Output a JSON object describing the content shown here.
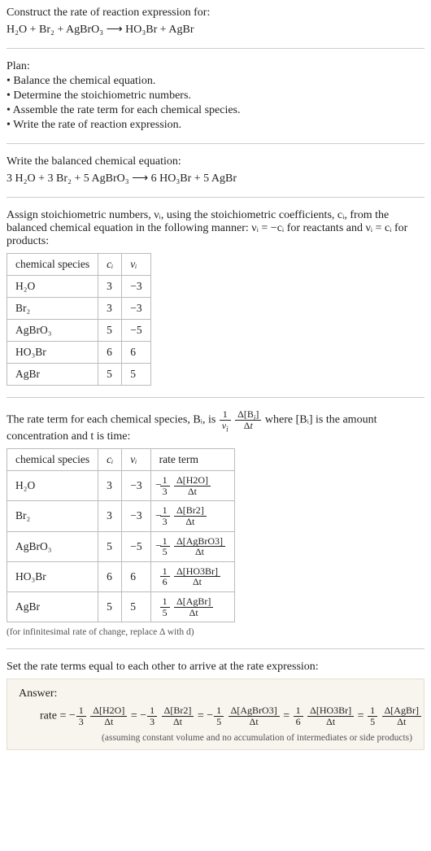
{
  "intro": {
    "line1": "Construct the rate of reaction expression for:",
    "eq": "H₂O + Br₂ + AgBrO₃ ⟶ HO₃Br + AgBr"
  },
  "plan": {
    "heading": "Plan:",
    "items": [
      "• Balance the chemical equation.",
      "• Determine the stoichiometric numbers.",
      "• Assemble the rate term for each chemical species.",
      "• Write the rate of reaction expression."
    ]
  },
  "balanced": {
    "line1": "Write the balanced chemical equation:",
    "eq": "3 H₂O + 3 Br₂ + 5 AgBrO₃ ⟶ 6 HO₃Br + 5 AgBr"
  },
  "assign": {
    "paragraph": "Assign stoichiometric numbers, νᵢ, using the stoichiometric coefficients, cᵢ, from the balanced chemical equation in the following manner: νᵢ = −cᵢ for reactants and νᵢ = cᵢ for products:",
    "headers": [
      "chemical species",
      "cᵢ",
      "νᵢ"
    ],
    "rows": [
      [
        "H₂O",
        "3",
        "−3"
      ],
      [
        "Br₂",
        "3",
        "−3"
      ],
      [
        "AgBrO₃",
        "5",
        "−5"
      ],
      [
        "HO₃Br",
        "6",
        "6"
      ],
      [
        "AgBr",
        "5",
        "5"
      ]
    ]
  },
  "rateterm": {
    "paragraph": "",
    "headers": [
      "chemical species",
      "cᵢ",
      "νᵢ",
      "rate term"
    ],
    "rows": [
      {
        "sp": "H₂O",
        "c": "3",
        "v": "−3",
        "coef": "− ⅓",
        "dnum": "Δ[H2O]",
        "dden": "Δt"
      },
      {
        "sp": "Br₂",
        "c": "3",
        "v": "−3",
        "coef": "− ⅓",
        "dnum": "Δ[Br2]",
        "dden": "Δt"
      },
      {
        "sp": "AgBrO₃",
        "c": "5",
        "v": "−5",
        "coef": "− ⅕",
        "dnum": "Δ[AgBrO3]",
        "dden": "Δt"
      },
      {
        "sp": "HO₃Br",
        "c": "6",
        "v": "6",
        "coef": "⅙",
        "dnum": "Δ[HO3Br]",
        "dden": "Δt"
      },
      {
        "sp": "AgBr",
        "c": "5",
        "v": "5",
        "coef": "⅕",
        "dnum": "Δ[AgBr]",
        "dden": "Δt"
      }
    ],
    "note": "(for infinitesimal rate of change, replace Δ with d)"
  },
  "sentence_before_rateterm_1": "The rate term for each chemical species, Bᵢ, is ",
  "sentence_before_rateterm_2": " where [Bᵢ] is the amount concentration and t is time:",
  "setequal": "Set the rate terms equal to each other to arrive at the rate expression:",
  "answer": {
    "label": "Answer:",
    "prefix": "rate = ",
    "terms": [
      {
        "coef": "− ⅓",
        "dnum": "Δ[H2O]",
        "dden": "Δt"
      },
      {
        "coef": "− ⅓",
        "dnum": "Δ[Br2]",
        "dden": "Δt"
      },
      {
        "coef": "− ⅕",
        "dnum": "Δ[AgBrO3]",
        "dden": "Δt"
      },
      {
        "coef": "⅙",
        "dnum": "Δ[HO3Br]",
        "dden": "Δt"
      },
      {
        "coef": "⅕",
        "dnum": "Δ[AgBr]",
        "dden": "Δt"
      }
    ],
    "note": "(assuming constant volume and no accumulation of intermediates or side products)"
  },
  "chart_data": {
    "type": "table",
    "tables": [
      {
        "title": "Stoichiometric numbers",
        "columns": [
          "chemical species",
          "c_i",
          "ν_i"
        ],
        "rows": [
          [
            "H2O",
            3,
            -3
          ],
          [
            "Br2",
            3,
            -3
          ],
          [
            "AgBrO3",
            5,
            -5
          ],
          [
            "HO3Br",
            6,
            6
          ],
          [
            "AgBr",
            5,
            5
          ]
        ]
      },
      {
        "title": "Rate terms",
        "columns": [
          "chemical species",
          "c_i",
          "ν_i",
          "rate term"
        ],
        "rows": [
          [
            "H2O",
            3,
            -3,
            "-(1/3) Δ[H2O]/Δt"
          ],
          [
            "Br2",
            3,
            -3,
            "-(1/3) Δ[Br2]/Δt"
          ],
          [
            "AgBrO3",
            5,
            -5,
            "-(1/5) Δ[AgBrO3]/Δt"
          ],
          [
            "HO3Br",
            6,
            6,
            "(1/6) Δ[HO3Br]/Δt"
          ],
          [
            "AgBr",
            5,
            5,
            "(1/5) Δ[AgBr]/Δt"
          ]
        ]
      }
    ]
  }
}
